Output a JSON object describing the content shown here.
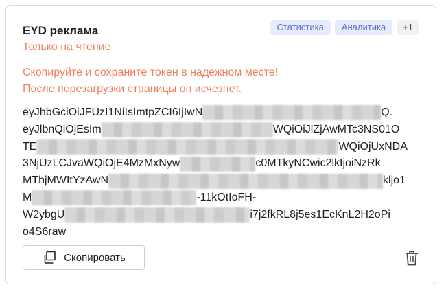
{
  "card": {
    "title": "EYD реклама",
    "subtitle": "Только на чтение",
    "tags": [
      "Статистика",
      "Аналитика",
      "+1"
    ],
    "warning_line1": "Скопируйте и сохраните токен в надежном месте!",
    "warning_line2": "После перезагрузки страницы он исчезнет.",
    "token_lines": [
      {
        "start": "eyJhbGciOiJFUzI1NiIsImtpZCI6IjIwN",
        "end": "Q."
      },
      {
        "start": "eyJlbnQiOjEsIm",
        "end": "WQiOiJlZjAwMTc3NS01O"
      },
      {
        "start": "TE",
        "end": "WQiOjUxNDA"
      },
      {
        "start": "3NjUzLCJvaWQiOjE4MzMxNyw",
        "end": "c0MTkyNCwic2lkIjoiNzRk"
      },
      {
        "start": "MThjMWItYzAwN",
        "end": "kljo1"
      },
      {
        "start": "M",
        "end": "-11kOtIoFH-"
      },
      {
        "start": "W2ybgU",
        "end": "i7j2fkRL8j5es1EcKnL2H2oPi"
      },
      {
        "start": "o4S6raw",
        "end": ""
      }
    ],
    "copy_label": "Скопировать",
    "icons": {
      "copy": "copy-icon",
      "delete": "trash-icon"
    }
  }
}
